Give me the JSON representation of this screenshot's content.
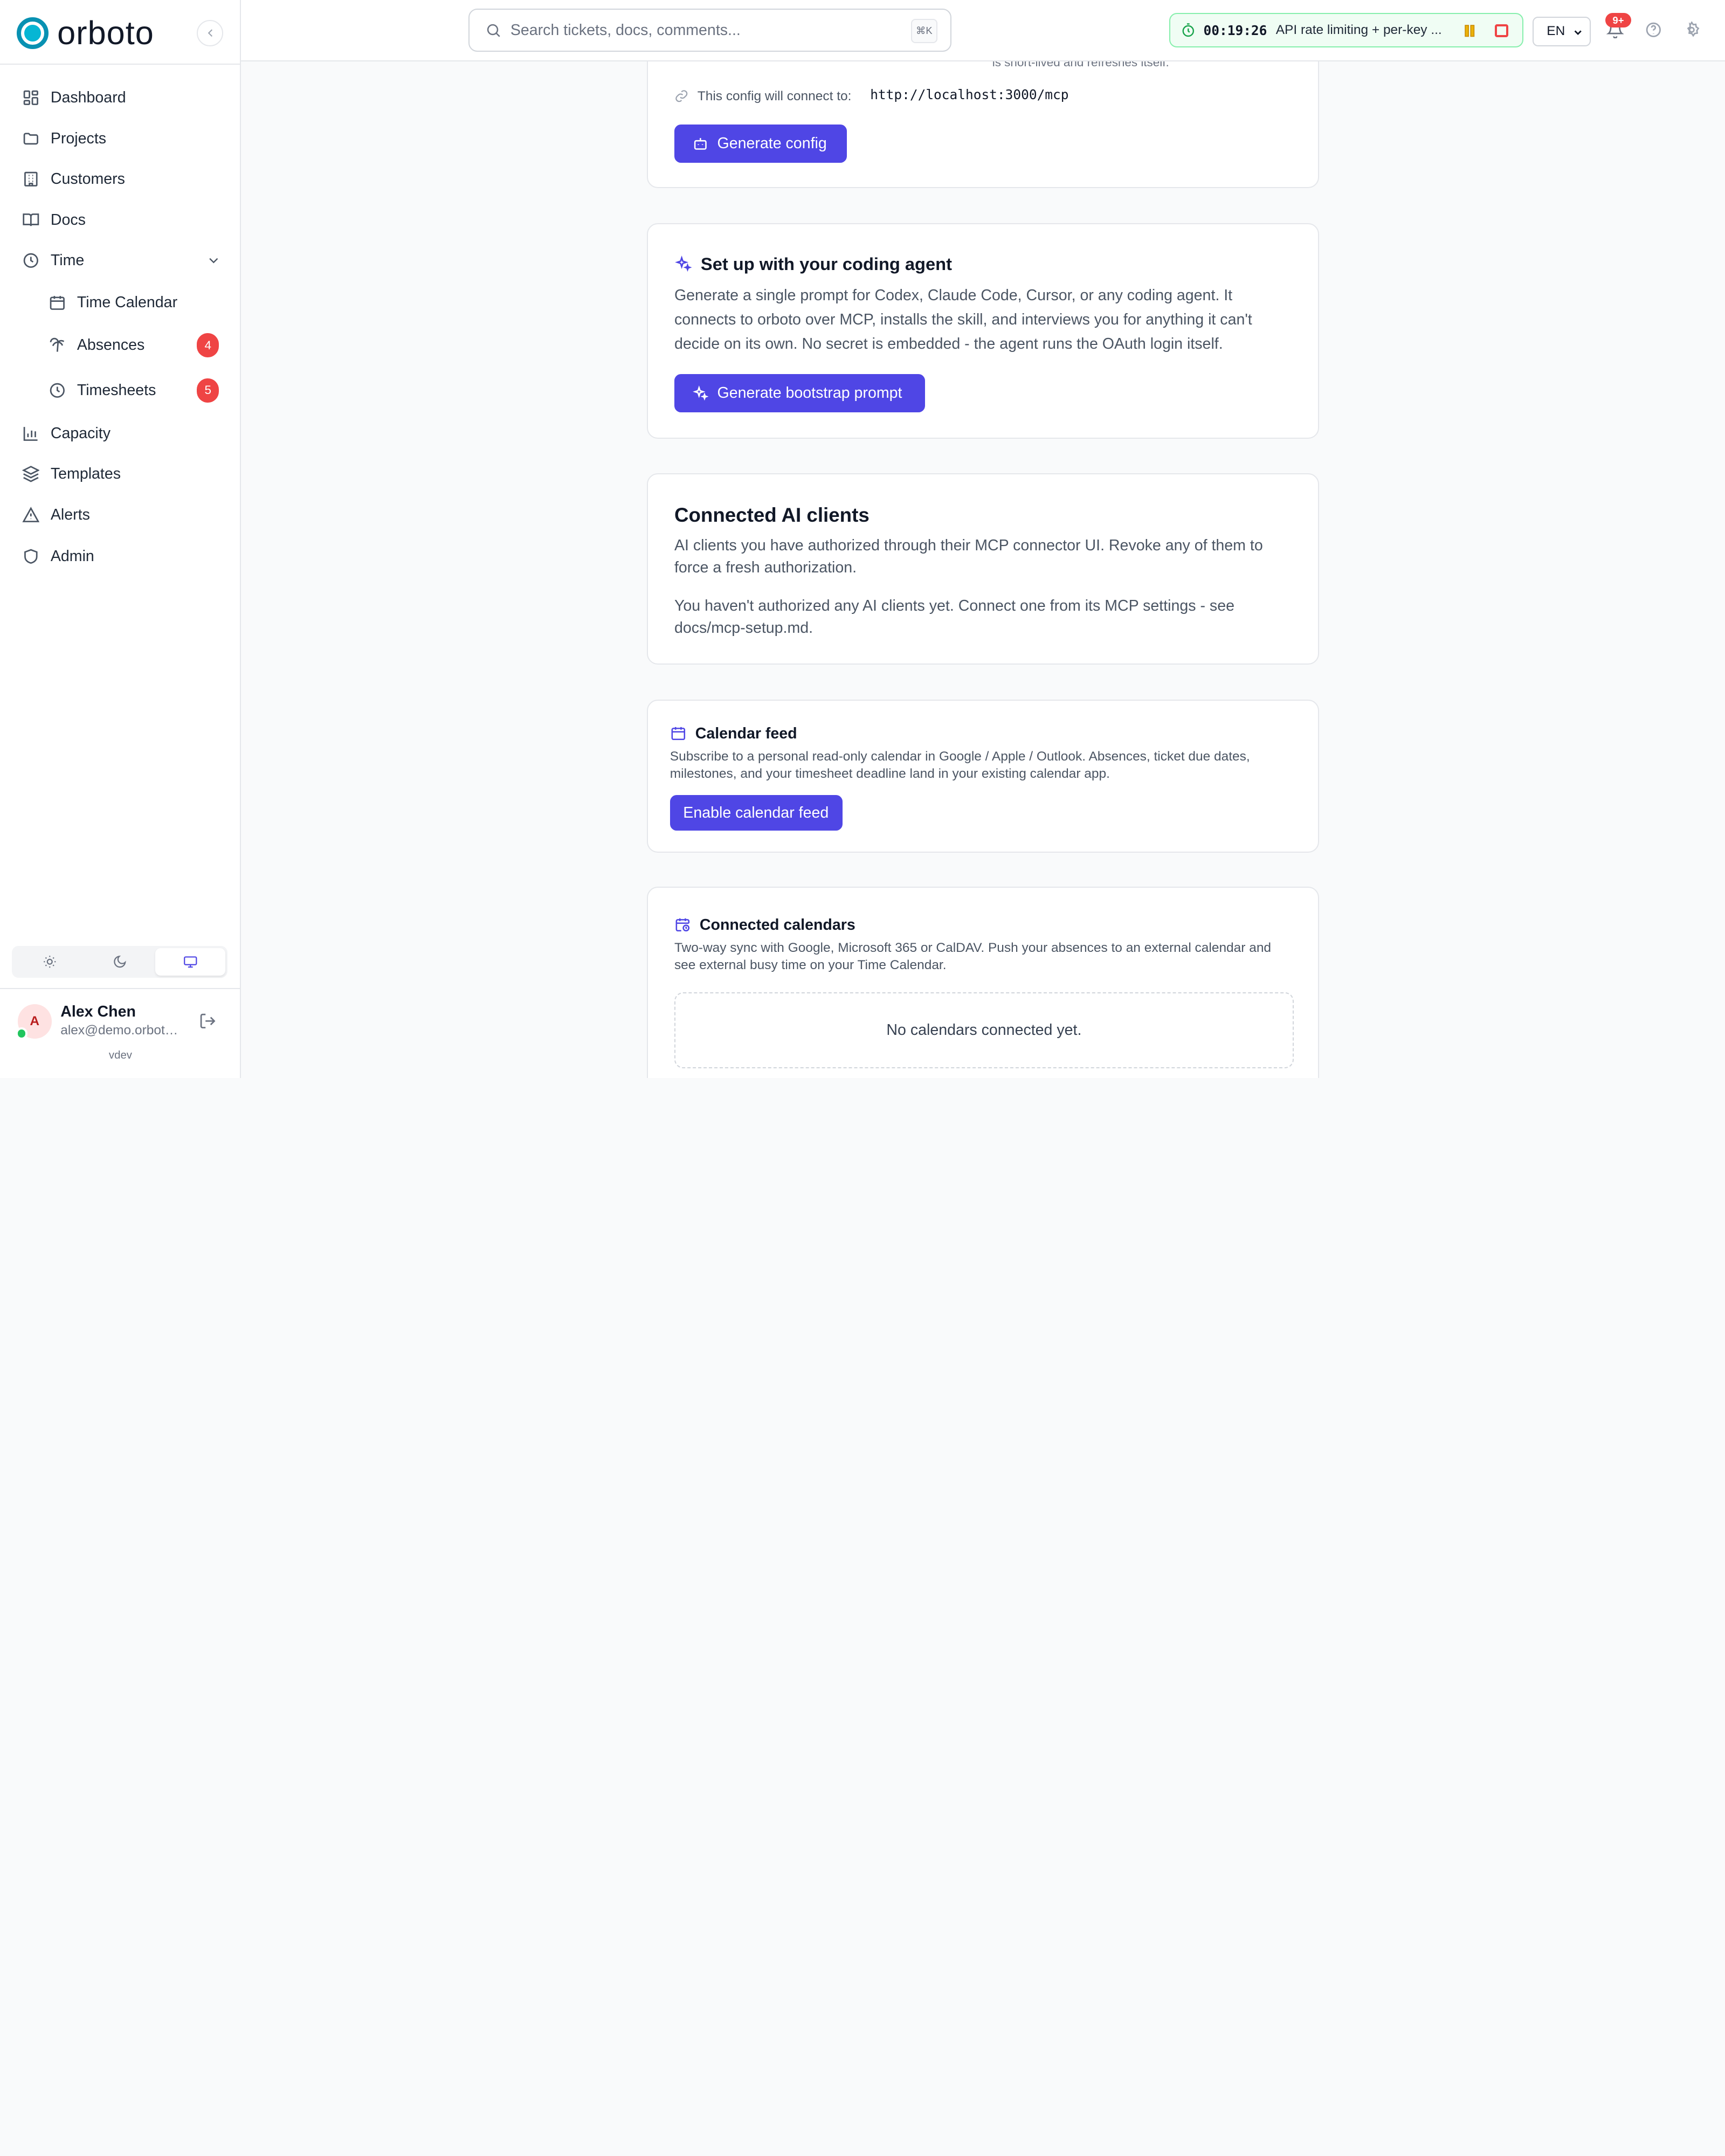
{
  "app": {
    "name": "orboto",
    "version": "vdev"
  },
  "sidebar": {
    "items": [
      {
        "label": "Dashboard",
        "icon": "dashboard-icon"
      },
      {
        "label": "Projects",
        "icon": "folder-icon"
      },
      {
        "label": "Customers",
        "icon": "building-icon"
      },
      {
        "label": "Docs",
        "icon": "book-icon"
      },
      {
        "label": "Time",
        "icon": "clock-icon",
        "expanded": true
      },
      {
        "label": "Time Calendar",
        "icon": "calendar-icon"
      },
      {
        "label": "Absences",
        "icon": "palm-tree-icon",
        "badge": "4"
      },
      {
        "label": "Timesheets",
        "icon": "clock-icon",
        "badge": "5"
      },
      {
        "label": "Capacity",
        "icon": "bar-chart-icon"
      },
      {
        "label": "Templates",
        "icon": "layers-icon"
      },
      {
        "label": "Alerts",
        "icon": "alert-triangle-icon"
      },
      {
        "label": "Admin",
        "icon": "shield-icon"
      }
    ],
    "theme_options": [
      "light",
      "dark",
      "system"
    ],
    "theme_selected": "system"
  },
  "user": {
    "initial": "A",
    "name": "Alex Chen",
    "email": "alex@demo.orboto.io",
    "status": "online"
  },
  "topbar": {
    "search_placeholder": "Search tickets, docs, comments...",
    "search_shortcut": "⌘K",
    "timer_time": "00:19:26",
    "timer_task": "API rate limiting + per-key ...",
    "language": "EN",
    "notifications_badge": "9+"
  },
  "main": {
    "partial_text": "is short-lived and refreshes itself.",
    "connect_label": "This config will connect to:",
    "connect_url": "http://localhost:3000/mcp",
    "generate_config_label": "Generate config",
    "coding_agent": {
      "title": "Set up with your coding agent",
      "description": "Generate a single prompt for Codex, Claude Code, Cursor, or any coding agent. It connects to orboto over MCP, installs the skill, and interviews you for anything it can't decide on its own. No secret is embedded - the agent runs the OAuth login itself.",
      "button": "Generate bootstrap prompt"
    },
    "connected_ai": {
      "title": "Connected AI clients",
      "description": "AI clients you have authorized through their MCP connector UI. Revoke any of them to force a fresh authorization.",
      "empty": "You haven't authorized any AI clients yet. Connect one from its MCP settings - see docs/mcp-setup.md."
    },
    "calendar_feed": {
      "title": "Calendar feed",
      "description": "Subscribe to a personal read-only calendar in Google / Apple / Outlook. Absences, ticket due dates, milestones, and your timesheet deadline land in your existing calendar app.",
      "button": "Enable calendar feed"
    },
    "connected_calendars": {
      "title": "Connected calendars",
      "description": "Two-way sync with Google, Microsoft 365 or CalDAV. Push your absences to an external calendar and see external busy time on your Time Calendar.",
      "empty": "No calendars connected yet."
    }
  },
  "colors": {
    "accent": "#4f46e5",
    "brand": "#0891b2",
    "badge": "#ef4444",
    "timer_border": "#86efac"
  }
}
